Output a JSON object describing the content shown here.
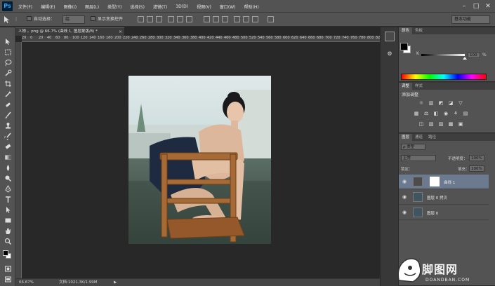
{
  "app": {
    "logo": "Ps"
  },
  "menu": [
    "文件(F)",
    "编辑(E)",
    "图像(I)",
    "图层(L)",
    "类型(Y)",
    "选择(S)",
    "滤镜(T)",
    "3D(D)",
    "视图(V)",
    "窗口(W)",
    "帮助(H)"
  ],
  "window_controls": {
    "minimize": "–",
    "restore": "□",
    "close": "✕"
  },
  "options": {
    "auto_select_label": "自动选择：",
    "auto_select_value": "组",
    "show_transform_label": "显示变换控件",
    "workspace": "基本功能"
  },
  "document": {
    "tab_title": "人物 。png @ 66.7% (曲线 1, 图层蒙版/8) *",
    "tab_close": "×",
    "zoom": "66.67%",
    "doc_info": "文档:1021.3K/1.99M",
    "ruler_marks": [
      "20",
      "0",
      "20",
      "40",
      "60",
      "80",
      "100",
      "120",
      "140",
      "160",
      "180",
      "200",
      "220",
      "240",
      "260",
      "280",
      "300",
      "320",
      "340",
      "360",
      "380",
      "400",
      "420",
      "440",
      "460",
      "480",
      "500",
      "520",
      "540",
      "560",
      "580",
      "600",
      "620",
      "640",
      "660",
      "680",
      "700",
      "720",
      "740",
      "760",
      "780",
      "800",
      "820"
    ]
  },
  "color_panel": {
    "tabs": [
      "颜色",
      "色板"
    ],
    "channel_label": "K",
    "value": "100",
    "unit": "%",
    "level": 1.0
  },
  "adjust_panel": {
    "tabs": [
      "调整",
      "样式"
    ],
    "title": "添加调整"
  },
  "layers_panel": {
    "tabs": [
      "图层",
      "通道",
      "路径"
    ],
    "kind_label": "ρ 类型",
    "blend_mode": "正常",
    "opacity_label": "不透明度：",
    "opacity_value": "100%",
    "lock_label": "锁定：",
    "fill_label": "填充：",
    "fill_value": "100%",
    "layers": [
      {
        "name": "曲线 1",
        "selected": true
      },
      {
        "name": "图层 0 拷贝",
        "selected": false
      },
      {
        "name": "图层 0",
        "selected": false
      }
    ]
  },
  "watermark": {
    "text": "脚图网",
    "sub": "DOANDBAN.COM"
  },
  "colors": {
    "accent_blue": "#31a8ff",
    "ui_dark": "#282828",
    "panel_gray": "#535353",
    "selection": "#6c7a8f"
  }
}
